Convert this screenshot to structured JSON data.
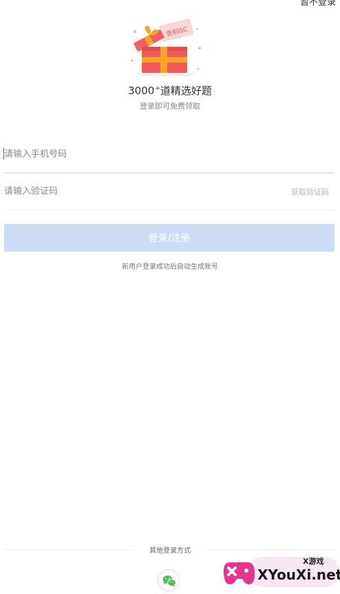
{
  "header": {
    "top_right_link": "暂不登录"
  },
  "promo": {
    "gift_tag": "告别GC",
    "headline_number": "3000",
    "headline_sup": "+",
    "headline_text": "道精选好题",
    "subline": "登录即可免费领取"
  },
  "form": {
    "phone_placeholder": "请输入手机号码",
    "code_placeholder": "请输入验证码",
    "get_code_label": "获取验证码",
    "login_button": "登录/注册",
    "hint": "新用户登录成功后自动生成账号"
  },
  "footer": {
    "other_login_label": "其他登录方式",
    "wechat_icon": "wechat-icon"
  },
  "watermark": {
    "small_text": "X游戏",
    "domain": "XYouXi.net"
  },
  "colors": {
    "button_bg": "#cddcf6",
    "gift_red": "#f05a5a",
    "gift_ribbon": "#f6a623",
    "wechat_green": "#4cbb54",
    "watermark_pink": "#e6348f"
  }
}
